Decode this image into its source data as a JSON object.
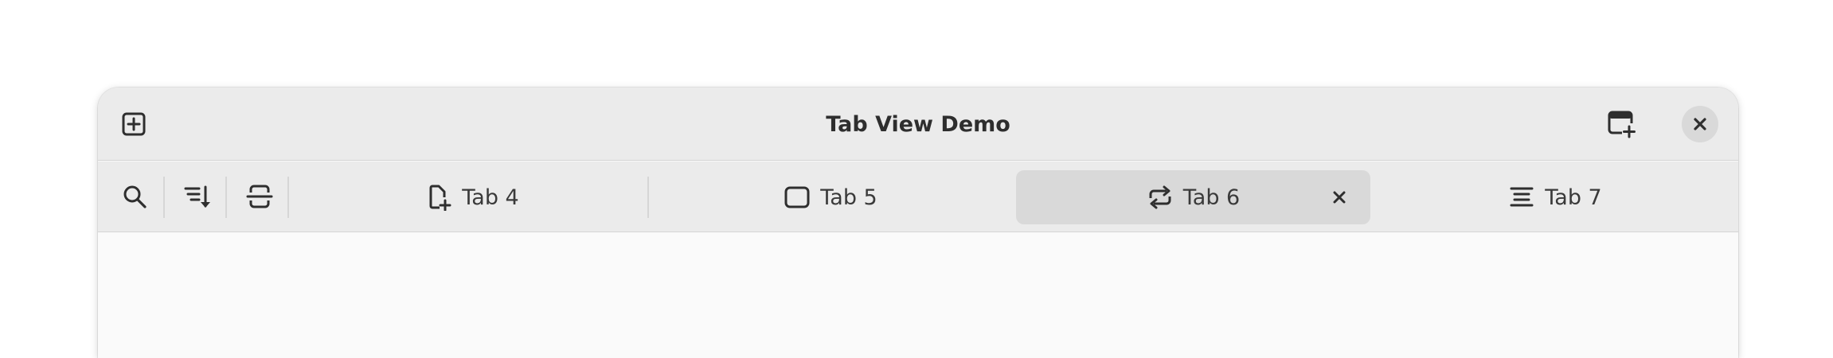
{
  "window": {
    "title": "Tab View Demo"
  },
  "headerbar": {
    "left_button_icon": "tab-new-icon",
    "right_buttons": [
      {
        "icon": "window-new-icon"
      },
      {
        "icon": "window-close-icon"
      }
    ]
  },
  "tabbar": {
    "start_actions": [
      {
        "icon": "search-icon"
      },
      {
        "icon": "sort-descending-icon"
      },
      {
        "icon": "page-break-icon"
      }
    ],
    "tabs": [
      {
        "label": "Tab 4",
        "icon": "document-new-icon",
        "selected": false
      },
      {
        "label": "Tab 5",
        "icon": "window-frame-icon",
        "selected": false
      },
      {
        "label": "Tab 6",
        "icon": "media-playlist-repeat-icon",
        "selected": true,
        "closable": true
      },
      {
        "label": "Tab 7",
        "icon": "justify-fill-icon",
        "selected": false
      }
    ]
  },
  "colors": {
    "headerbar_bg": "#ebebeb",
    "selected_tab_bg": "#d9d9d9",
    "content_bg": "#fafafa",
    "text": "#2e2e2e"
  }
}
